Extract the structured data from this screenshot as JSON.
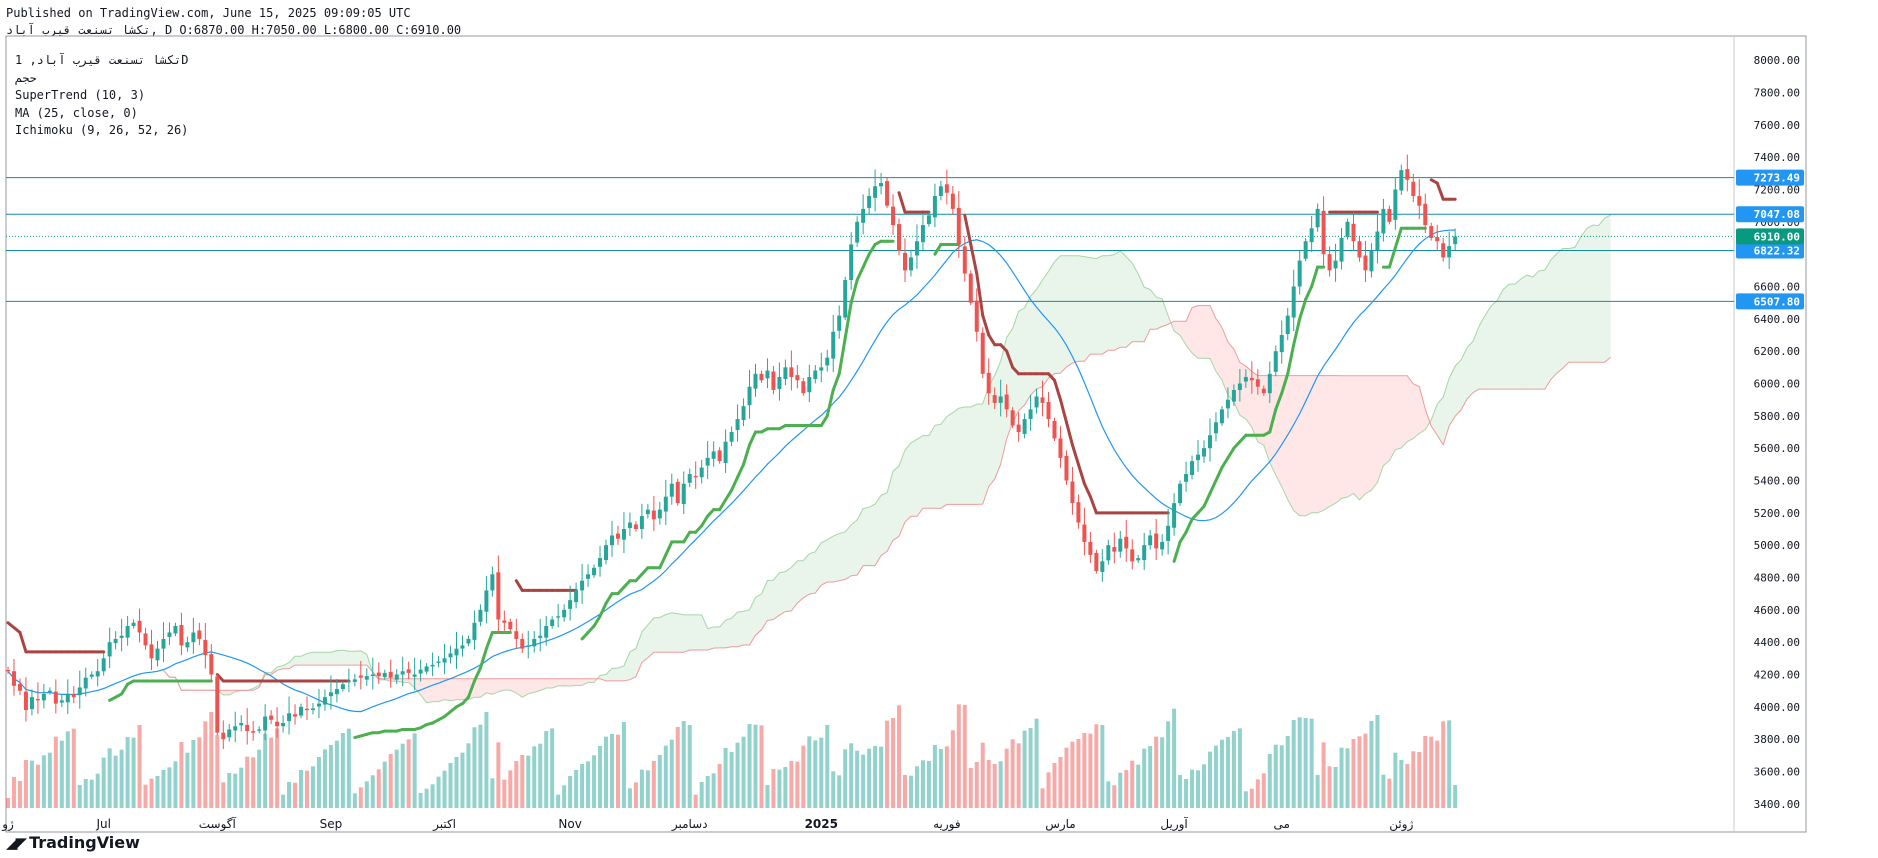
{
  "header": {
    "published": "Published on TradingView.com, June 15, 2025 09:09:05 UTC",
    "symbol_line": "تکشا تسنعت قیرب آباد, D O:6870.00 H:7050.00 L:6800.00 C:6910.00"
  },
  "legend": {
    "symbol": "تکشا تسنعت قیرب آباد, 1D",
    "volume_label": "حجم",
    "supertrend": "SuperTrend (10, 3)",
    "ma": "MA (25, close, 0)",
    "ichimoku": "Ichimoku (9, 26, 52, 26)"
  },
  "brand": {
    "name": "TradingView",
    "logo_icon": "tradingview-logo-icon"
  },
  "colors": {
    "up": "#26a69a",
    "down": "#ef5350",
    "supertrend_up": "#4caf50",
    "supertrend_down": "#a94442",
    "ma": "#2196f3",
    "hline": "#138ca4",
    "last_price": "#089981"
  },
  "chart_data": {
    "type": "candlestick",
    "ylim": [
      3300,
      8100
    ],
    "y_ticks": [
      3400,
      3600,
      3800,
      4000,
      4200,
      4400,
      4600,
      4800,
      5000,
      5200,
      5400,
      5600,
      5800,
      6000,
      6200,
      6400,
      6600,
      6800,
      7000,
      7200,
      7400,
      7600,
      7800,
      8000
    ],
    "x_labels": [
      {
        "label": "ژو",
        "bar": 0
      },
      {
        "label": "Jul",
        "bar": 16
      },
      {
        "label": "آگوست",
        "bar": 35
      },
      {
        "label": "Sep",
        "bar": 54
      },
      {
        "label": "اکتبر",
        "bar": 73
      },
      {
        "label": "Nov",
        "bar": 94
      },
      {
        "label": "دسامبر",
        "bar": 114
      },
      {
        "label": "2025",
        "bar": 136
      },
      {
        "label": "فوریه",
        "bar": 157
      },
      {
        "label": "مارس",
        "bar": 176
      },
      {
        "label": "آوریل",
        "bar": 195
      },
      {
        "label": "می",
        "bar": 213
      },
      {
        "label": "ژوئن",
        "bar": 233
      }
    ],
    "price_lines": [
      {
        "label": "7273.49",
        "value": 7273.49
      },
      {
        "label": "7047.08",
        "value": 7047.08
      },
      {
        "label": "6822.32",
        "value": 6822.32
      },
      {
        "label": "6507.80",
        "value": 6507.8
      }
    ],
    "last_price": {
      "label": "6910.00",
      "value": 6910
    },
    "closes": [
      4220,
      4130,
      4100,
      3980,
      4060,
      4040,
      4080,
      4100,
      4020,
      4040,
      4080,
      4060,
      4120,
      4180,
      4200,
      4220,
      4300,
      4400,
      4420,
      4440,
      4500,
      4520,
      4460,
      4380,
      4300,
      4360,
      4420,
      4460,
      4500,
      4380,
      4400,
      4460,
      4420,
      4320,
      4200,
      3840,
      3800,
      3860,
      3880,
      3900,
      3850,
      3840,
      3860,
      3940,
      3920,
      3880,
      3900,
      3960,
      3940,
      4000,
      3980,
      3990,
      4020,
      4060,
      4090,
      4110,
      4140,
      4160,
      4170,
      4180,
      4190,
      4200,
      4190,
      4210,
      4180,
      4200,
      4220,
      4210,
      4200,
      4230,
      4250,
      4260,
      4280,
      4300,
      4330,
      4360,
      4380,
      4420,
      4520,
      4600,
      4720,
      4820,
      4540,
      4520,
      4480,
      4420,
      4360,
      4380,
      4420,
      4440,
      4500,
      4540,
      4560,
      4600,
      4660,
      4720,
      4780,
      4820,
      4860,
      4920,
      5000,
      5060,
      5040,
      5100,
      5140,
      5100,
      5180,
      5220,
      5160,
      5220,
      5300,
      5380,
      5260,
      5380,
      5440,
      5420,
      5480,
      5540,
      5580,
      5520,
      5640,
      5700,
      5780,
      5860,
      5980,
      6060,
      6020,
      6080,
      5960,
      6040,
      6100,
      6040,
      6020,
      5940,
      6040,
      6080,
      6100,
      6160,
      6320,
      6420,
      6640,
      6860,
      7000,
      7080,
      7160,
      7220,
      7240,
      7100,
      6980,
      6820,
      6700,
      6780,
      6880,
      6980,
      7040,
      7160,
      7220,
      7180,
      7080,
      6860,
      6680,
      6500,
      6320,
      6060,
      5940,
      5880,
      5920,
      5840,
      5740,
      5700,
      5780,
      5840,
      5920,
      5880,
      5780,
      5660,
      5540,
      5400,
      5260,
      5140,
      5020,
      4940,
      4840,
      4900,
      5000,
      4960,
      5040,
      4980,
      4900,
      4920,
      5000,
      5060,
      4980,
      5020,
      5120,
      5260,
      5380,
      5440,
      5520,
      5560,
      5600,
      5680,
      5760,
      5840,
      5900,
      5960,
      6000,
      6040,
      6020,
      5980,
      5940,
      6060,
      6200,
      6300,
      6420,
      6600,
      6760,
      6880,
      6960,
      7080,
      6800,
      6700,
      6760,
      6900,
      7000,
      6880,
      6780,
      6700,
      6820,
      6940,
      7080,
      7000,
      7200,
      7320,
      7260,
      7160,
      7100,
      6980,
      6900,
      6880,
      6780,
      6850,
      6910
    ]
  }
}
